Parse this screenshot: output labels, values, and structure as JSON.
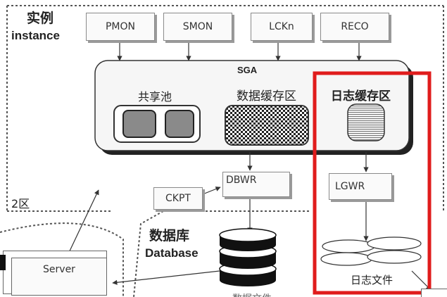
{
  "instance": {
    "title_cn": "实例",
    "title_en": "instance",
    "zone_label": "2区"
  },
  "background_processes": [
    "PMON",
    "SMON",
    "LCKn",
    "RECO"
  ],
  "sga": {
    "title": "SGA",
    "shared_pool_label": "共享池",
    "buffer_cache_label": "数据缓存区",
    "redo_buffer_label": "日志缓存区"
  },
  "writers": {
    "dbwr": "DBWR",
    "ckpt": "CKPT",
    "lgwr": "LGWR"
  },
  "database": {
    "title_cn": "数据库",
    "title_en": "Database",
    "log_files_label": "日志文件",
    "data_files_label": "数据文件"
  },
  "server": {
    "label": "Server"
  },
  "colors": {
    "highlight": "#e01c1c",
    "border": "#666666",
    "shadow": "#9a9a9a"
  }
}
